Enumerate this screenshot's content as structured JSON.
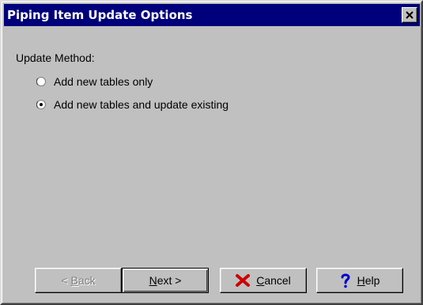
{
  "window": {
    "title": "Piping Item Update Options",
    "close_label": "close"
  },
  "form": {
    "group_label": "Update Method:",
    "options": [
      {
        "label": "Add new tables only",
        "selected": false
      },
      {
        "label": "Add new tables and update existing",
        "selected": true
      }
    ]
  },
  "buttons": {
    "back": {
      "mnemonic": "B",
      "rest": "ack",
      "prefix": "< ",
      "enabled": false
    },
    "next": {
      "mnemonic": "N",
      "rest": "ext >",
      "enabled": true
    },
    "cancel": {
      "mnemonic": "C",
      "rest": "ancel",
      "icon": "x-cancel-icon",
      "icon_color": "#cc0000"
    },
    "help": {
      "mnemonic": "H",
      "rest": "elp",
      "icon": "question-mark-icon",
      "icon_color": "#0000cc"
    }
  },
  "colors": {
    "titlebar": "#00007b",
    "face": "#c0c0c0"
  }
}
